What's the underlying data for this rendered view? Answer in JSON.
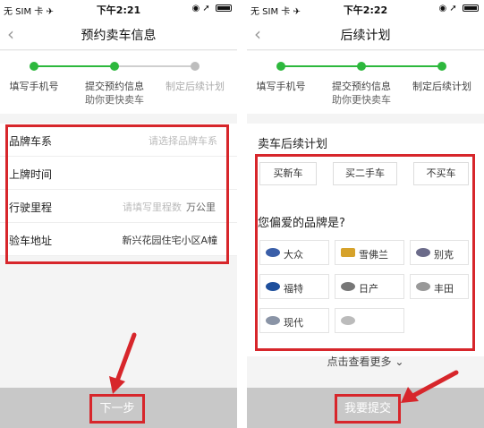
{
  "left": {
    "status": {
      "carrier": "无 SIM 卡 ✈",
      "time": "下午2:21"
    },
    "nav": {
      "back_glyph": "‹",
      "title": "预约卖车信息"
    },
    "steps": [
      {
        "label": "填写手机号"
      },
      {
        "label": "提交预约信息",
        "sub": "助你更快卖车"
      },
      {
        "label": "制定后续计划"
      }
    ],
    "form": [
      {
        "key": "品牌车系",
        "value": "请选择品牌车系"
      },
      {
        "key": "上牌时间",
        "value": ""
      },
      {
        "key": "行驶里程",
        "value": "请填写里程数",
        "unit": "万公里"
      },
      {
        "key": "验车地址",
        "value": "新兴花园住宅小区A幢"
      }
    ],
    "button": "下一步"
  },
  "right": {
    "status": {
      "carrier": "无 SIM 卡 ✈",
      "time": "下午2:22"
    },
    "nav": {
      "back_glyph": "‹",
      "title": "后续计划"
    },
    "steps": [
      {
        "label": "填写手机号"
      },
      {
        "label": "提交预约信息",
        "sub": "助你更快卖车"
      },
      {
        "label": "制定后续计划"
      }
    ],
    "plan_title": "卖车后续计划",
    "options": [
      "买新车",
      "买二手车",
      "不买车"
    ],
    "brand_question": "您偏爱的品牌是?",
    "brands": [
      "大众",
      "雪佛兰",
      "别克",
      "福特",
      "日产",
      "丰田",
      "现代",
      ""
    ],
    "more": "点击查看更多",
    "button": "我要提交"
  },
  "colors": {
    "active": "#2db83d",
    "inactive": "#bdbdbd",
    "highlight": "#d7262b"
  }
}
